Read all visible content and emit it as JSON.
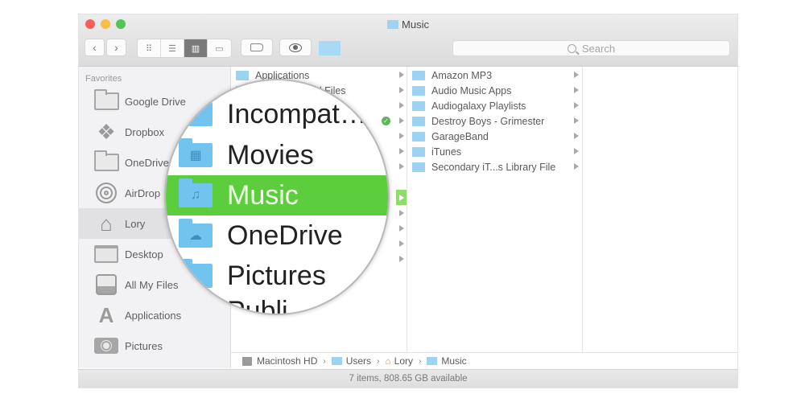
{
  "window": {
    "title": "Music",
    "colors": {
      "selection_green": "#5ccd3c",
      "folder_blue": "#9cd2f2"
    }
  },
  "toolbar": {
    "back_icon": "chevron-left-icon",
    "forward_icon": "chevron-right-icon",
    "views": [
      {
        "name": "icon-view",
        "glyph": "⠿",
        "active": false
      },
      {
        "name": "list-view",
        "glyph": "☰",
        "active": false
      },
      {
        "name": "column-view",
        "glyph": "▥",
        "active": true
      },
      {
        "name": "cover-flow-view",
        "glyph": "▭",
        "active": false
      }
    ],
    "search_placeholder": "Search"
  },
  "sidebar": {
    "heading": "Favorites",
    "items": [
      {
        "label": "Google Drive",
        "icon": "folder-icon"
      },
      {
        "label": "Dropbox",
        "icon": "dropbox-icon"
      },
      {
        "label": "OneDrive",
        "icon": "folder-icon"
      },
      {
        "label": "AirDrop",
        "icon": "airdrop-icon"
      },
      {
        "label": "Lory",
        "icon": "home-icon",
        "selected": true
      },
      {
        "label": "Desktop",
        "icon": "desktop-icon"
      },
      {
        "label": "All My Files",
        "icon": "all-files-icon"
      },
      {
        "label": "Applications",
        "icon": "applications-icon"
      },
      {
        "label": "Pictures",
        "icon": "camera-icon"
      }
    ]
  },
  "column1": {
    "visible_items": [
      "Applications",
      "Creative Cloud Files"
    ],
    "magnified_items": [
      {
        "label": "Incompat…",
        "glyph": ""
      },
      {
        "label": "Movies",
        "glyph": "▦"
      },
      {
        "label": "Music",
        "glyph": "♫",
        "selected": true
      },
      {
        "label": "OneDrive",
        "glyph": "☁"
      },
      {
        "label": "Pictures",
        "glyph": ""
      },
      {
        "label": "Publi…",
        "glyph": ""
      }
    ],
    "synced_badge": "✓"
  },
  "column2": {
    "items": [
      "Amazon MP3",
      "Audio Music Apps",
      "Audiogalaxy Playlists",
      "Destroy Boys - Grimester",
      "GarageBand",
      "iTunes",
      "Secondary iT...s Library File"
    ]
  },
  "pathbar": {
    "segments": [
      "Macintosh HD",
      "Users",
      "Lory",
      "Music"
    ],
    "separator": "›"
  },
  "status": {
    "text": "7 items, 808.65 GB available"
  }
}
